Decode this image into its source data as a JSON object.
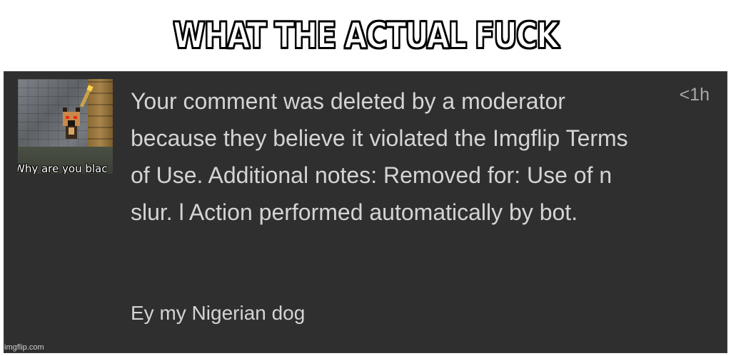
{
  "meme": {
    "top_caption": "WHAT THE ACTUAL FUCK",
    "watermark": "imgflip.com"
  },
  "notification": {
    "thumbnail": {
      "caption": "Why are you blac"
    },
    "message": "Your comment was deleted by a moderator because they believe it violated the Imgflip Terms of Use. Additional notes: Removed for: Use of n slur. l Action performed automatically by bot.",
    "timestamp": "<1h",
    "comment": "Ey my Nigerian dog"
  },
  "colors": {
    "panel_background": "#2f2f30",
    "text_primary": "#d4d4d6",
    "text_secondary": "#a8a8ac",
    "caption_fill": "#ffffff",
    "caption_outline": "#000000"
  }
}
